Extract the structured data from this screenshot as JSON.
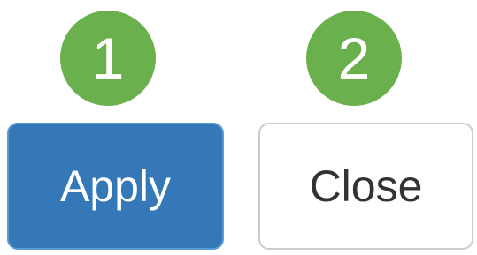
{
  "badges": [
    {
      "label": "1"
    },
    {
      "label": "2"
    }
  ],
  "buttons": {
    "apply_label": "Apply",
    "close_label": "Close"
  },
  "colors": {
    "badge_green": "#6ab04c",
    "apply_blue": "#3478b8"
  }
}
